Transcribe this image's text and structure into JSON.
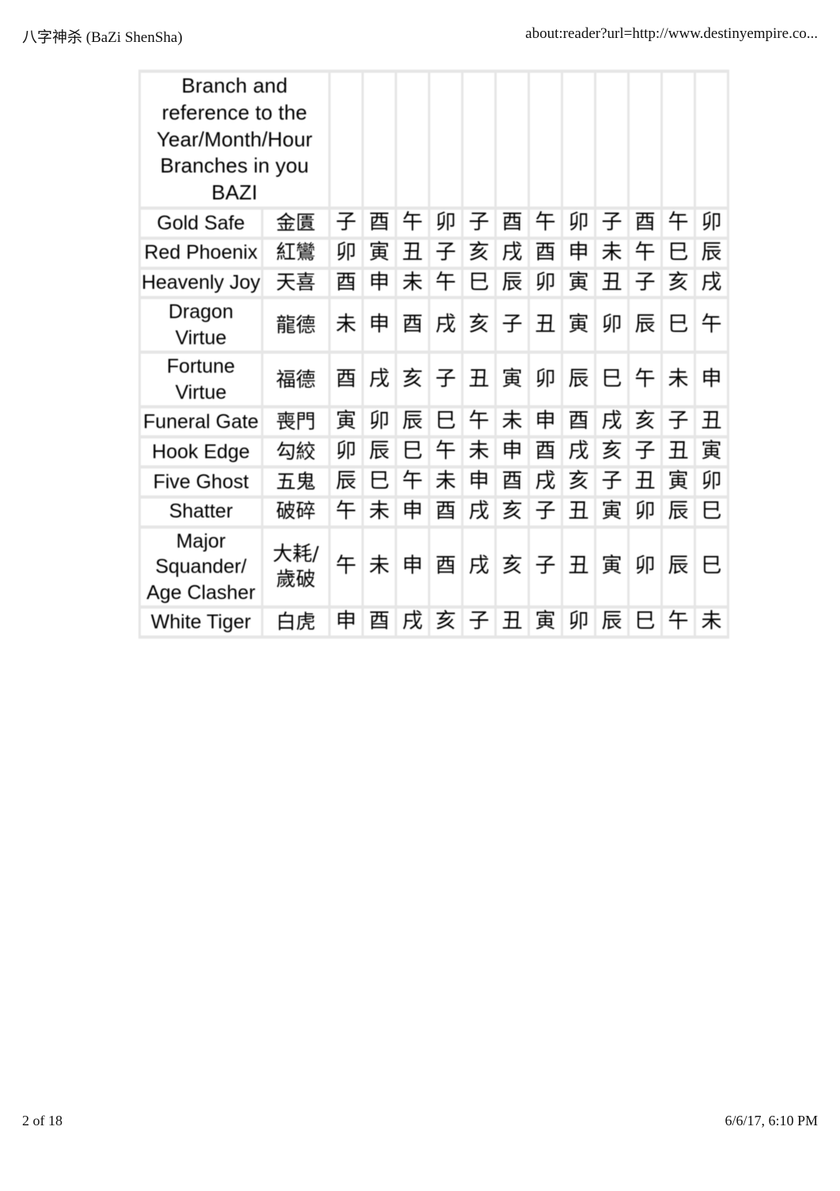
{
  "page": {
    "header_left": "八字神杀 (BaZi ShenSha)",
    "header_right": "about:reader?url=http://www.destinyempire.co...",
    "footer_left": "2 of 18",
    "footer_right": "6/6/17, 6:10 PM"
  },
  "table": {
    "header_title": "Branch and reference to the Year/Month/Hour Branches in you BAZI",
    "column_count": 14,
    "branch_column_count": 12,
    "rows": [
      {
        "name": "Gold Safe",
        "chinese": "金匱",
        "branches": [
          "子",
          "酉",
          "午",
          "卯",
          "子",
          "酉",
          "午",
          "卯",
          "子",
          "酉",
          "午",
          "卯"
        ]
      },
      {
        "name": "Red Phoenix",
        "chinese": "紅鸞",
        "branches": [
          "卯",
          "寅",
          "丑",
          "子",
          "亥",
          "戌",
          "酉",
          "申",
          "未",
          "午",
          "巳",
          "辰"
        ]
      },
      {
        "name": "Heavenly Joy",
        "chinese": "天喜",
        "branches": [
          "酉",
          "申",
          "未",
          "午",
          "巳",
          "辰",
          "卯",
          "寅",
          "丑",
          "子",
          "亥",
          "戌"
        ]
      },
      {
        "name": "Dragon Virtue",
        "chinese": "龍德",
        "branches": [
          "未",
          "申",
          "酉",
          "戌",
          "亥",
          "子",
          "丑",
          "寅",
          "卯",
          "辰",
          "巳",
          "午"
        ]
      },
      {
        "name": "Fortune Virtue",
        "chinese": "福德",
        "branches": [
          "酉",
          "戌",
          "亥",
          "子",
          "丑",
          "寅",
          "卯",
          "辰",
          "巳",
          "午",
          "未",
          "申"
        ]
      },
      {
        "name": "Funeral Gate",
        "chinese": "喪門",
        "branches": [
          "寅",
          "卯",
          "辰",
          "巳",
          "午",
          "未",
          "申",
          "酉",
          "戌",
          "亥",
          "子",
          "丑"
        ]
      },
      {
        "name": "Hook Edge",
        "chinese": "勾絞",
        "branches": [
          "卯",
          "辰",
          "巳",
          "午",
          "未",
          "申",
          "酉",
          "戌",
          "亥",
          "子",
          "丑",
          "寅"
        ]
      },
      {
        "name": "Five Ghost",
        "chinese": "五鬼",
        "branches": [
          "辰",
          "巳",
          "午",
          "未",
          "申",
          "酉",
          "戌",
          "亥",
          "子",
          "丑",
          "寅",
          "卯"
        ]
      },
      {
        "name": "Shatter",
        "chinese": "破碎",
        "branches": [
          "午",
          "未",
          "申",
          "酉",
          "戌",
          "亥",
          "子",
          "丑",
          "寅",
          "卯",
          "辰",
          "巳"
        ]
      },
      {
        "name": "Major Squander/ Age Clasher",
        "chinese": "大耗/歲破",
        "branches": [
          "午",
          "未",
          "申",
          "酉",
          "戌",
          "亥",
          "子",
          "丑",
          "寅",
          "卯",
          "辰",
          "巳"
        ]
      },
      {
        "name": "White Tiger",
        "chinese": "白虎",
        "branches": [
          "申",
          "酉",
          "戌",
          "亥",
          "子",
          "丑",
          "寅",
          "卯",
          "辰",
          "巳",
          "午",
          "未"
        ]
      }
    ]
  }
}
